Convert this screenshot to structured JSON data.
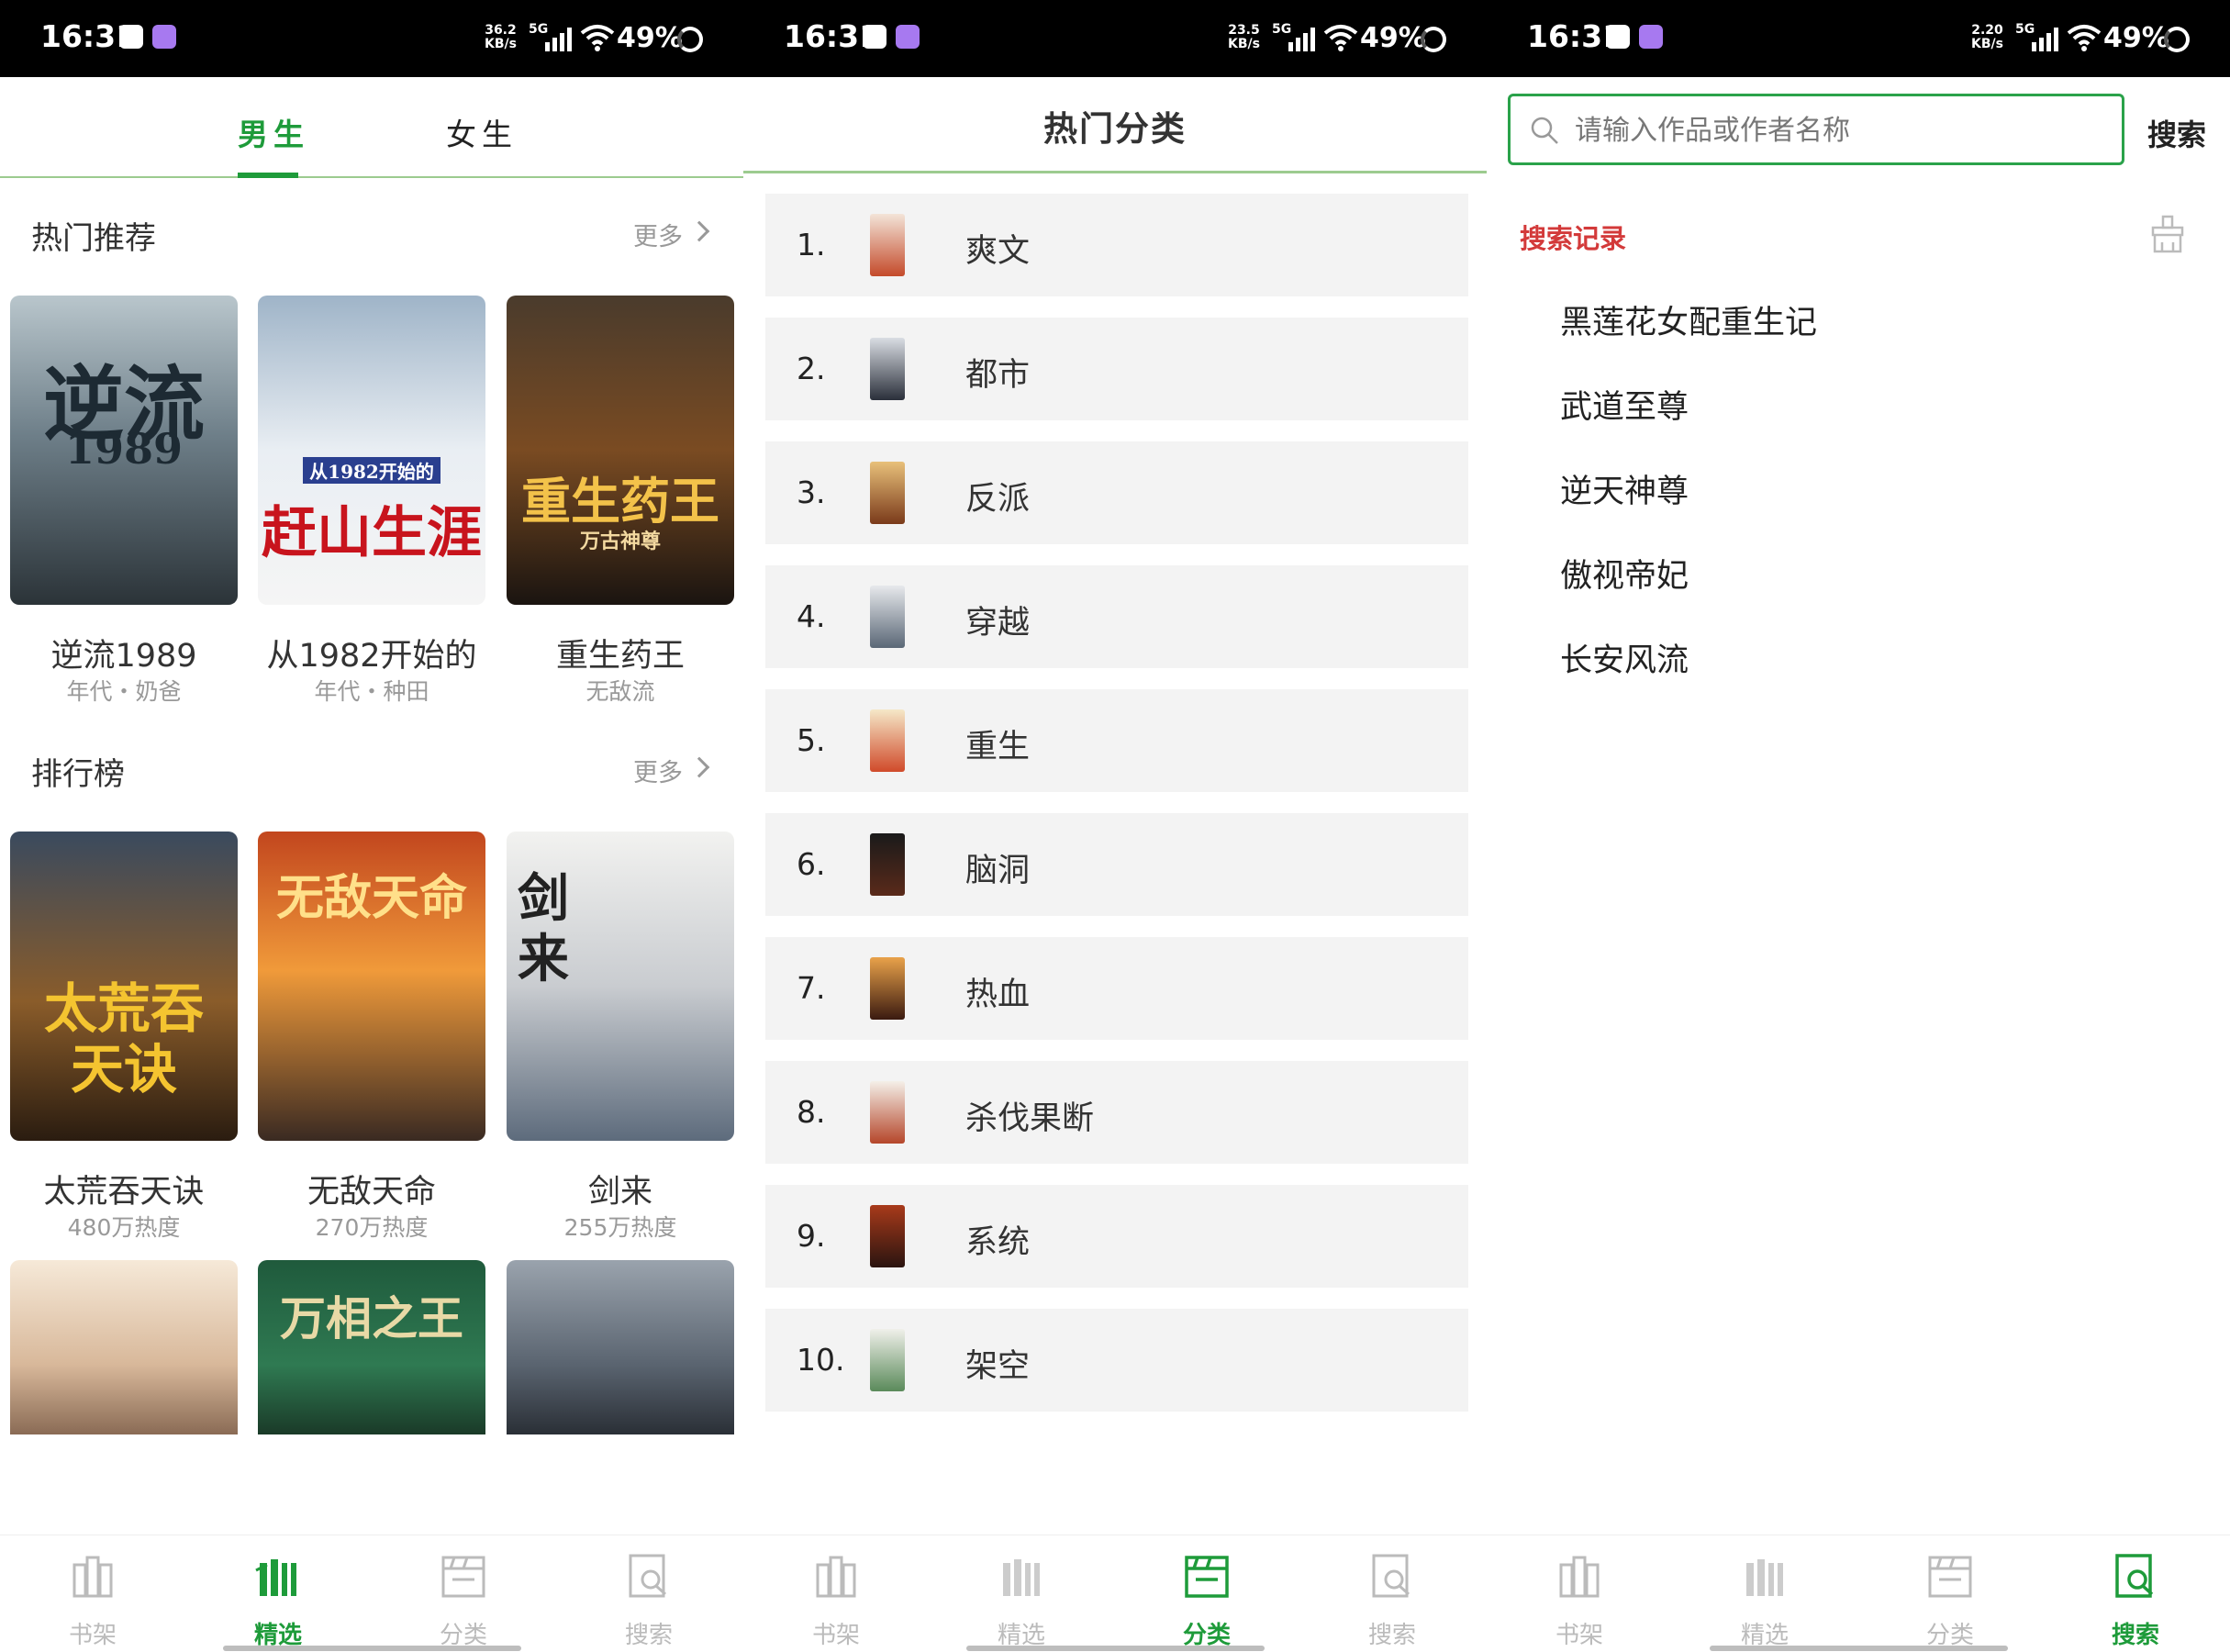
{
  "status_bars": [
    {
      "time": "16:31",
      "speed": "36.2",
      "speed_unit": "KB/s",
      "network": "5G",
      "battery": "49%"
    },
    {
      "time": "16:31",
      "speed": "23.5",
      "speed_unit": "KB/s",
      "network": "5G",
      "battery": "49%"
    },
    {
      "time": "16:31",
      "speed": "2.20",
      "speed_unit": "KB/s",
      "network": "5G",
      "battery": "49%"
    }
  ],
  "bottom_nav": [
    {
      "label": "书架",
      "icon": "bookshelf-icon"
    },
    {
      "label": "精选",
      "icon": "featured-books-icon"
    },
    {
      "label": "分类",
      "icon": "category-icon"
    },
    {
      "label": "搜索",
      "icon": "search-book-icon"
    }
  ],
  "colors": {
    "accent": "#1e9b3a",
    "history_title": "#d33a3a",
    "row_bg": "#f3f3f3"
  },
  "featured": {
    "tabs": [
      "男生",
      "女生"
    ],
    "hot": {
      "title": "热门推荐",
      "more": "更多",
      "books": [
        {
          "title": "逆流1989",
          "sub": "年代・奶爸",
          "cover_text": "逆流",
          "cover_text2": "1989"
        },
        {
          "title": "从1982开始的",
          "sub": "年代・种田",
          "cover_text": "赶山生涯",
          "cover_text2": "从1982开始的"
        },
        {
          "title": "重生药王",
          "sub": "无敌流",
          "cover_text": "重生药王",
          "cover_text2": "万古神尊"
        }
      ]
    },
    "rank": {
      "title": "排行榜",
      "more": "更多",
      "books": [
        {
          "title": "太荒吞天诀",
          "sub": "480万热度",
          "cover_text": "太荒吞天诀"
        },
        {
          "title": "无敌天命",
          "sub": "270万热度",
          "cover_text": "无敌天命"
        },
        {
          "title": "剑来",
          "sub": "255万热度",
          "cover_text": "剑来"
        }
      ],
      "more_covers": [
        {
          "cover_text": ""
        },
        {
          "cover_text": "万相之王"
        },
        {
          "cover_text": ""
        }
      ]
    }
  },
  "categories": {
    "title": "热门分类",
    "items": [
      {
        "num": "1.",
        "name": "爽文"
      },
      {
        "num": "2.",
        "name": "都市"
      },
      {
        "num": "3.",
        "name": "反派"
      },
      {
        "num": "4.",
        "name": "穿越"
      },
      {
        "num": "5.",
        "name": "重生"
      },
      {
        "num": "6.",
        "name": "脑洞"
      },
      {
        "num": "7.",
        "name": "热血"
      },
      {
        "num": "8.",
        "name": "杀伐果断"
      },
      {
        "num": "9.",
        "name": "系统"
      },
      {
        "num": "10.",
        "name": "架空"
      }
    ]
  },
  "search": {
    "placeholder": "请输入作品或作者名称",
    "button": "搜索",
    "history_title": "搜索记录",
    "history": [
      "黑莲花女配重生记",
      "武道至尊",
      "逆天神尊",
      "傲视帝妃",
      "长安风流"
    ]
  }
}
